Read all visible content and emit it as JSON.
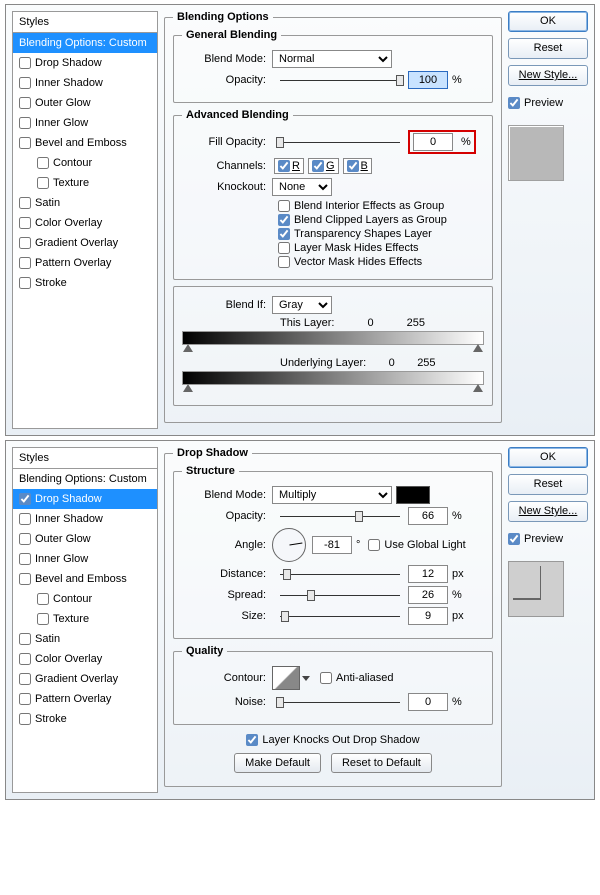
{
  "shared": {
    "styles_header": "Styles",
    "style_items": [
      {
        "label": "Blending Options: Custom",
        "sub": false
      },
      {
        "label": "Drop Shadow",
        "sub": false
      },
      {
        "label": "Inner Shadow",
        "sub": false
      },
      {
        "label": "Outer Glow",
        "sub": false
      },
      {
        "label": "Inner Glow",
        "sub": false
      },
      {
        "label": "Bevel and Emboss",
        "sub": false
      },
      {
        "label": "Contour",
        "sub": true
      },
      {
        "label": "Texture",
        "sub": true
      },
      {
        "label": "Satin",
        "sub": false
      },
      {
        "label": "Color Overlay",
        "sub": false
      },
      {
        "label": "Gradient Overlay",
        "sub": false
      },
      {
        "label": "Pattern Overlay",
        "sub": false
      },
      {
        "label": "Stroke",
        "sub": false
      }
    ],
    "ok": "OK",
    "reset": "Reset",
    "new_style": "New Style...",
    "preview": "Preview"
  },
  "top": {
    "title": "Blending Options",
    "general": {
      "legend": "General Blending",
      "blend_mode_label": "Blend Mode:",
      "blend_mode_value": "Normal",
      "opacity_label": "Opacity:",
      "opacity_value": "100",
      "pct": "%"
    },
    "advanced": {
      "legend": "Advanced Blending",
      "fill_label": "Fill Opacity:",
      "fill_value": "0",
      "pct": "%",
      "channels_label": "Channels:",
      "ch_r": "R",
      "ch_g": "G",
      "ch_b": "B",
      "knockout_label": "Knockout:",
      "knockout_value": "None",
      "c1": "Blend Interior Effects as Group",
      "c2": "Blend Clipped Layers as Group",
      "c3": "Transparency Shapes Layer",
      "c4": "Layer Mask Hides Effects",
      "c5": "Vector Mask Hides Effects"
    },
    "blendif": {
      "label": "Blend If:",
      "value": "Gray",
      "this_layer": "This Layer:",
      "v0": "0",
      "v255": "255",
      "underlying": "Underlying Layer:"
    }
  },
  "bottom": {
    "title": "Drop Shadow",
    "structure": {
      "legend": "Structure",
      "blend_mode_label": "Blend Mode:",
      "blend_mode_value": "Multiply",
      "opacity_label": "Opacity:",
      "opacity_value": "66",
      "pct": "%",
      "angle_label": "Angle:",
      "angle_value": "-81",
      "deg": "°",
      "use_global": "Use Global Light",
      "distance_label": "Distance:",
      "distance_value": "12",
      "px": "px",
      "spread_label": "Spread:",
      "spread_value": "26",
      "size_label": "Size:",
      "size_value": "9"
    },
    "quality": {
      "legend": "Quality",
      "contour_label": "Contour:",
      "anti_aliased": "Anti-aliased",
      "noise_label": "Noise:",
      "noise_value": "0",
      "pct": "%"
    },
    "knocks": "Layer Knocks Out Drop Shadow",
    "make_default": "Make Default",
    "reset_default": "Reset to Default"
  }
}
